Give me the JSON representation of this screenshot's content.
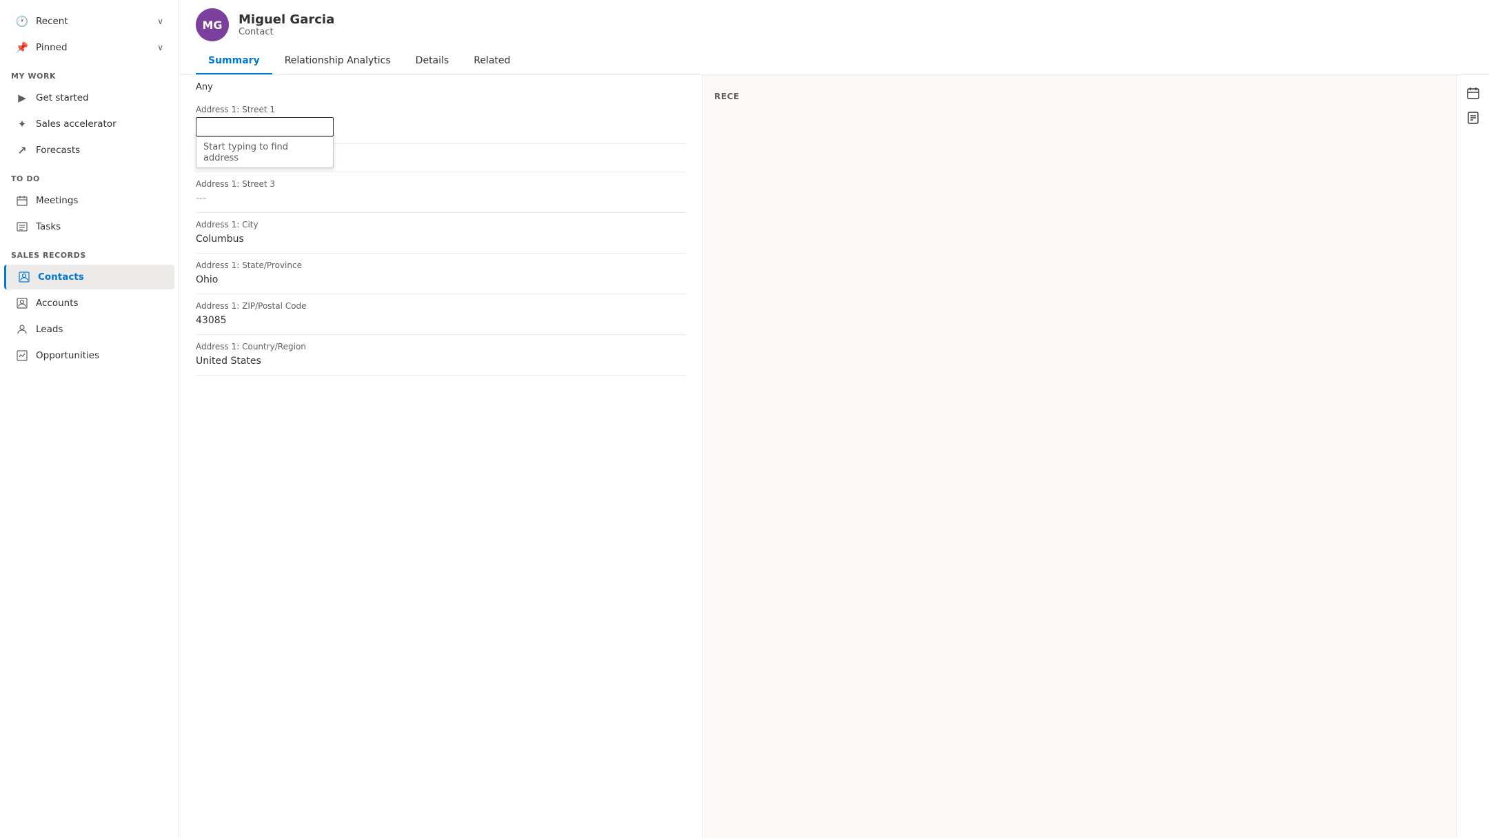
{
  "sidebar": {
    "sections": [
      {
        "label": "",
        "items": [
          {
            "id": "recent",
            "label": "Recent",
            "icon": "recent",
            "expandable": true
          },
          {
            "id": "pinned",
            "label": "Pinned",
            "icon": "pinned",
            "expandable": true
          }
        ]
      },
      {
        "label": "My work",
        "items": [
          {
            "id": "get-started",
            "label": "Get started",
            "icon": "getstarted"
          },
          {
            "id": "sales-accelerator",
            "label": "Sales accelerator",
            "icon": "accelerator"
          },
          {
            "id": "forecasts",
            "label": "Forecasts",
            "icon": "forecasts"
          }
        ]
      },
      {
        "label": "To do",
        "items": [
          {
            "id": "meetings",
            "label": "Meetings",
            "icon": "meetings"
          },
          {
            "id": "tasks",
            "label": "Tasks",
            "icon": "tasks"
          }
        ]
      },
      {
        "label": "Sales records",
        "items": [
          {
            "id": "contacts",
            "label": "Contacts",
            "icon": "contacts",
            "active": true
          },
          {
            "id": "accounts",
            "label": "Accounts",
            "icon": "accounts"
          },
          {
            "id": "leads",
            "label": "Leads",
            "icon": "leads"
          },
          {
            "id": "opportunities",
            "label": "Opportunities",
            "icon": "opportunities"
          }
        ]
      }
    ]
  },
  "header": {
    "avatar_initials": "MG",
    "avatar_color": "#7b3f9e",
    "contact_name": "Miguel Garcia",
    "contact_type": "Contact",
    "tabs": [
      {
        "id": "summary",
        "label": "Summary",
        "active": true
      },
      {
        "id": "relationship-analytics",
        "label": "Relationship Analytics"
      },
      {
        "id": "details",
        "label": "Details"
      },
      {
        "id": "related",
        "label": "Related"
      }
    ]
  },
  "form": {
    "any_label": "Any",
    "fields": [
      {
        "id": "address1-street1",
        "label": "Address 1: Street 1",
        "type": "input",
        "value": "",
        "show_dropdown": true,
        "dropdown_hint": "Start typing to find address"
      },
      {
        "id": "address1-street2",
        "label": "",
        "type": "dash",
        "value": "---"
      },
      {
        "id": "address1-street3",
        "label": "Address 1: Street 3",
        "type": "dash",
        "value": "---"
      },
      {
        "id": "address1-city",
        "label": "Address 1: City",
        "type": "text",
        "value": "Columbus"
      },
      {
        "id": "address1-state",
        "label": "Address 1: State/Province",
        "type": "text",
        "value": "Ohio"
      },
      {
        "id": "address1-zip",
        "label": "Address 1: ZIP/Postal Code",
        "type": "text",
        "value": "43085"
      },
      {
        "id": "address1-country",
        "label": "Address 1: Country/Region",
        "type": "text",
        "value": "United States"
      }
    ]
  },
  "right_panel": {
    "recent_label": "RECE"
  },
  "icons": {
    "calendar": "📅",
    "note": "📝"
  }
}
